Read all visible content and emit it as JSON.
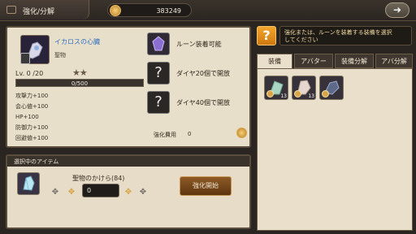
{
  "header": {
    "title": "強化/分解",
    "currency_value": "383249",
    "back_icon": "back-arrow-icon"
  },
  "item": {
    "name": "イカロスの心臓",
    "type": "聖物",
    "level_text": "Lv.  0 /20",
    "stars": "★★",
    "exp_text": "0/500",
    "stats": [
      "攻撃力+100",
      "会心値+100",
      "HP+100",
      "防御力+100",
      "回避値+100"
    ]
  },
  "rune_slots": [
    {
      "label": "ルーン装着可能"
    },
    {
      "label": "ダイヤ20個で開放"
    },
    {
      "label": "ダイヤ40個で開放"
    }
  ],
  "fee": {
    "label": "強化費用",
    "value": "0"
  },
  "selected": {
    "header": "選択中のアイテム",
    "item_name": "聖物のかけら(84)",
    "quantity": "0",
    "start_label": "強化開始"
  },
  "hint": {
    "text_line1": "強化または、ルーンを装着する装備を選択",
    "text_line2": "してください"
  },
  "tabs": [
    {
      "label": "装備"
    },
    {
      "label": "アバター"
    },
    {
      "label": "装備分解"
    },
    {
      "label": "アバ分解"
    }
  ],
  "equipment": [
    {
      "badge": "13"
    },
    {
      "badge": "13"
    },
    {
      "badge": ""
    }
  ]
}
